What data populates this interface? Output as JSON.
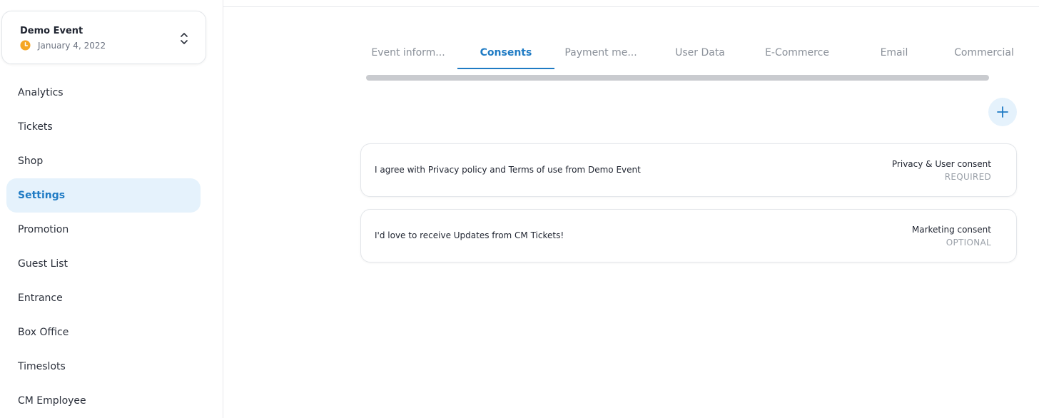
{
  "event": {
    "name": "Demo Event",
    "date": "January 4, 2022"
  },
  "sidebar": {
    "items": [
      {
        "label": "Analytics"
      },
      {
        "label": "Tickets"
      },
      {
        "label": "Shop"
      },
      {
        "label": "Settings"
      },
      {
        "label": "Promotion"
      },
      {
        "label": "Guest List"
      },
      {
        "label": "Entrance"
      },
      {
        "label": "Box Office"
      },
      {
        "label": "Timeslots"
      },
      {
        "label": "CM Employee"
      }
    ],
    "active": "Settings"
  },
  "tabs": [
    {
      "label": "Event inform..."
    },
    {
      "label": "Consents"
    },
    {
      "label": "Payment me..."
    },
    {
      "label": "User Data"
    },
    {
      "label": "E-Commerce"
    },
    {
      "label": "Email"
    },
    {
      "label": "Commercial"
    }
  ],
  "active_tab": "Consents",
  "consents": [
    {
      "text": "I agree with Privacy policy and Terms of use from Demo Event",
      "type": "Privacy & User consent",
      "requirement": "REQUIRED"
    },
    {
      "text": "I'd love to receive Updates from CM Tickets!",
      "type": "Marketing consent",
      "requirement": "OPTIONAL"
    }
  ],
  "icons": {
    "clock": "clock-icon",
    "switch": "chevron-up-down-icon",
    "add": "plus-icon"
  },
  "colors": {
    "accent": "#1f7bc4",
    "active_bg": "#e5f2fc",
    "clock": "#f5a623"
  }
}
